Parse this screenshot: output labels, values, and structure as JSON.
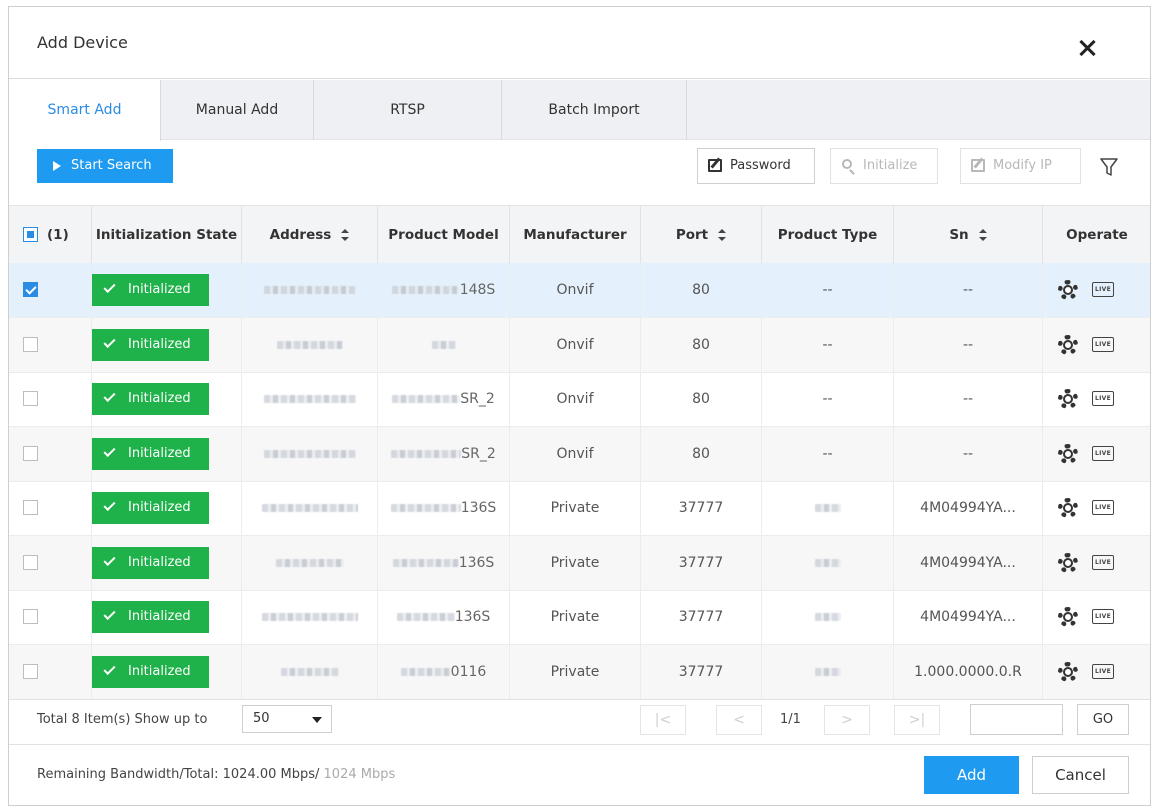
{
  "dialog": {
    "title": "Add Device"
  },
  "tabs": [
    {
      "label": "Smart Add",
      "active": true
    },
    {
      "label": "Manual Add",
      "active": false
    },
    {
      "label": "RTSP",
      "active": false
    },
    {
      "label": "Batch Import",
      "active": false
    }
  ],
  "toolbar": {
    "start_search": "Start Search",
    "password": "Password",
    "initialize": "Initialize",
    "modify_ip": "Modify IP"
  },
  "table": {
    "selected_count": "(1)",
    "headers": {
      "init_state": "Initialization State",
      "address": "Address",
      "product_model": "Product Model",
      "manufacturer": "Manufacturer",
      "port": "Port",
      "product_type": "Product Type",
      "sn": "Sn",
      "operate": "Operate"
    },
    "live_label": "LIVE",
    "rows": [
      {
        "checked": true,
        "state": "Initialized",
        "model_suffix": "148S",
        "manufacturer": "Onvif",
        "port": "80",
        "type": "--",
        "sn": "--"
      },
      {
        "checked": false,
        "state": "Initialized",
        "model_suffix": "",
        "manufacturer": "Onvif",
        "port": "80",
        "type": "--",
        "sn": "--"
      },
      {
        "checked": false,
        "state": "Initialized",
        "model_suffix": "SR_2",
        "manufacturer": "Onvif",
        "port": "80",
        "type": "--",
        "sn": "--"
      },
      {
        "checked": false,
        "state": "Initialized",
        "model_suffix": "SR_2",
        "manufacturer": "Onvif",
        "port": "80",
        "type": "--",
        "sn": "--"
      },
      {
        "checked": false,
        "state": "Initialized",
        "model_suffix": "136S",
        "manufacturer": "Private",
        "port": "37777",
        "type": "",
        "sn": "4M04994YA..."
      },
      {
        "checked": false,
        "state": "Initialized",
        "model_suffix": "136S",
        "manufacturer": "Private",
        "port": "37777",
        "type": "",
        "sn": "4M04994YA..."
      },
      {
        "checked": false,
        "state": "Initialized",
        "model_suffix": "136S",
        "manufacturer": "Private",
        "port": "37777",
        "type": "",
        "sn": "4M04994YA..."
      },
      {
        "checked": false,
        "state": "Initialized",
        "model_suffix": "0116",
        "manufacturer": "Private",
        "port": "37777",
        "type": "",
        "sn": "1.000.0000.0.R"
      }
    ]
  },
  "pagination": {
    "total_text": "Total 8 Item(s)  Show up to",
    "page_size": "50",
    "first": "|<",
    "prev": "<",
    "page_info": "1/1",
    "next": ">",
    "last": ">|",
    "go": "GO"
  },
  "footer": {
    "bandwidth_label": "Remaining Bandwidth/Total: 1024.00 Mbps/",
    "bandwidth_total": " 1024 Mbps",
    "add": "Add",
    "cancel": "Cancel"
  },
  "colors": {
    "accent": "#1e9af0",
    "success": "#1fb14a",
    "tab_active": "#2b8ce6"
  }
}
